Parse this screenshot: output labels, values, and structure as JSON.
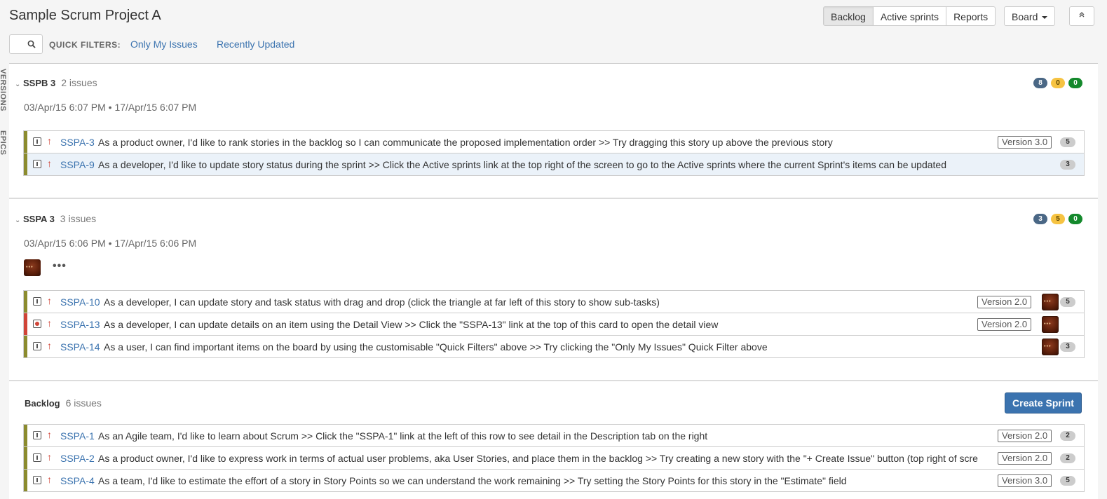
{
  "header": {
    "title": "Sample Scrum Project A",
    "views": [
      "Backlog",
      "Active sprints",
      "Reports"
    ],
    "active_view": "Backlog",
    "board_label": "Board",
    "quick_filters_label": "QUICK FILTERS:",
    "quick_filters": [
      "Only My Issues",
      "Recently Updated"
    ]
  },
  "side_tabs": [
    "VERSIONS",
    "EPICS"
  ],
  "sprints": [
    {
      "name": "SSPB 3",
      "issue_count": "2 issues",
      "start": "03/Apr/15 6:07 PM",
      "separator": "•",
      "end": "17/Apr/15 6:07 PM",
      "badges": [
        "8",
        "0",
        "0"
      ],
      "issues": [
        {
          "key": "SSPA-3",
          "summary": "As a product owner, I'd like to rank stories in the backlog so I can communicate the proposed implementation order >> Try dragging this story up above the previous story",
          "version": "Version 3.0",
          "points": "5",
          "type": "story"
        },
        {
          "key": "SSPA-9",
          "summary": "As a developer, I'd like to update story status during the sprint >> Click the Active sprints link at the top right of the screen to go to the Active sprints where the current Sprint's items can be updated",
          "version": "",
          "points": "3",
          "type": "story",
          "selected": true
        }
      ]
    },
    {
      "name": "SSPA 3",
      "issue_count": "3 issues",
      "start": "03/Apr/15 6:06 PM",
      "separator": "•",
      "end": "17/Apr/15 6:06 PM",
      "badges": [
        "3",
        "5",
        "0"
      ],
      "more": "•••",
      "issues": [
        {
          "key": "SSPA-10",
          "summary": "As a developer, I can update story and task status with drag and drop (click the triangle at far left of this story to show sub-tasks)",
          "version": "Version 2.0",
          "points": "5",
          "type": "story"
        },
        {
          "key": "SSPA-13",
          "summary": "As a developer, I can update details on an item using the Detail View >> Click the \"SSPA-13\" link at the top of this card to open the detail view",
          "version": "Version 2.0",
          "points": "",
          "type": "bug"
        },
        {
          "key": "SSPA-14",
          "summary": "As a user, I can find important items on the board by using the customisable \"Quick Filters\" above >> Try clicking the \"Only My Issues\" Quick Filter above",
          "version": "",
          "points": "3",
          "type": "story"
        }
      ]
    }
  ],
  "backlog": {
    "name": "Backlog",
    "issue_count": "6 issues",
    "create_label": "Create Sprint",
    "issues": [
      {
        "key": "SSPA-1",
        "summary": "As an Agile team, I'd like to learn about Scrum >> Click the \"SSPA-1\" link at the left of this row to see detail in the Description tab on the right",
        "version": "Version 2.0",
        "points": "2"
      },
      {
        "key": "SSPA-2",
        "summary": "As a product owner, I'd like to express work in terms of actual user problems, aka User Stories, and place them in the backlog >> Try creating a new story with the \"+ Create Issue\" button (top right of scre",
        "version": "Version 2.0",
        "points": "2"
      },
      {
        "key": "SSPA-4",
        "summary": "As a team, I'd like to estimate the effort of a story in Story Points so we can understand the work remaining >> Try setting the Story Points for this story in the \"Estimate\" field",
        "version": "Version 3.0",
        "points": "5"
      }
    ]
  }
}
